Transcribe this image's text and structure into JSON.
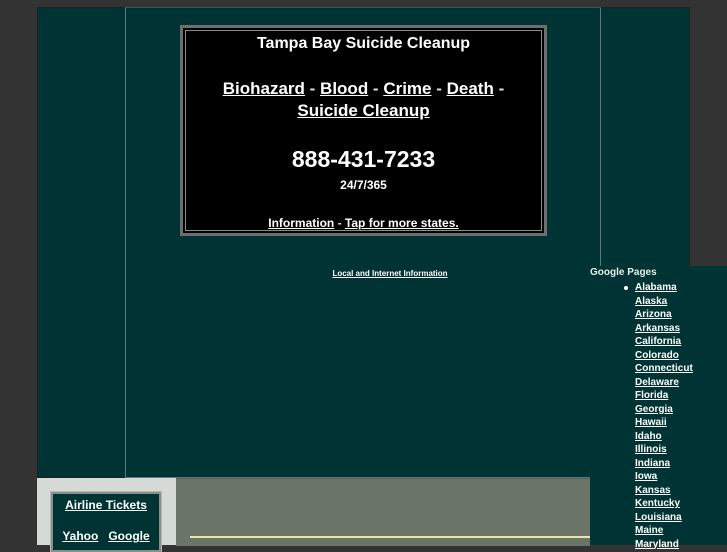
{
  "header": {
    "title": "Tampa Bay Suicide Cleanup",
    "categories": [
      "Biohazard",
      "Blood",
      "Crime",
      "Death",
      "Suicide Cleanup"
    ],
    "separator": " - ",
    "phone": "888-431-7233",
    "hours": "24/7/365",
    "info_link": "Information",
    "more_states_link": "Tap for more states."
  },
  "local_info_link": "Local and Internet Information",
  "google_pages": {
    "heading": "Google Pages",
    "states": [
      "Alabama",
      "Alaska",
      "Arizona",
      "Arkansas",
      "California",
      "Colorado",
      "Connecticut",
      "Delaware",
      "Florida",
      "Georgia",
      "Hawaii",
      "Idaho",
      "Illinois",
      "Indiana",
      "Iowa",
      "Kansas",
      "Kentucky",
      "Louisiana",
      "Maine",
      "Maryland"
    ]
  },
  "sidebar_box": {
    "airline_link": "Airline Tickets",
    "yahoo_link": "Yahoo",
    "google_link": "Google"
  },
  "colors": {
    "page_bg": "#333333",
    "panel_teal": "#003333",
    "black_box": "#000000",
    "bottom_left_bg": "#d6dad6",
    "bottom_mid_bg": "#6b7567",
    "accent_line": "#e8e4b0"
  }
}
